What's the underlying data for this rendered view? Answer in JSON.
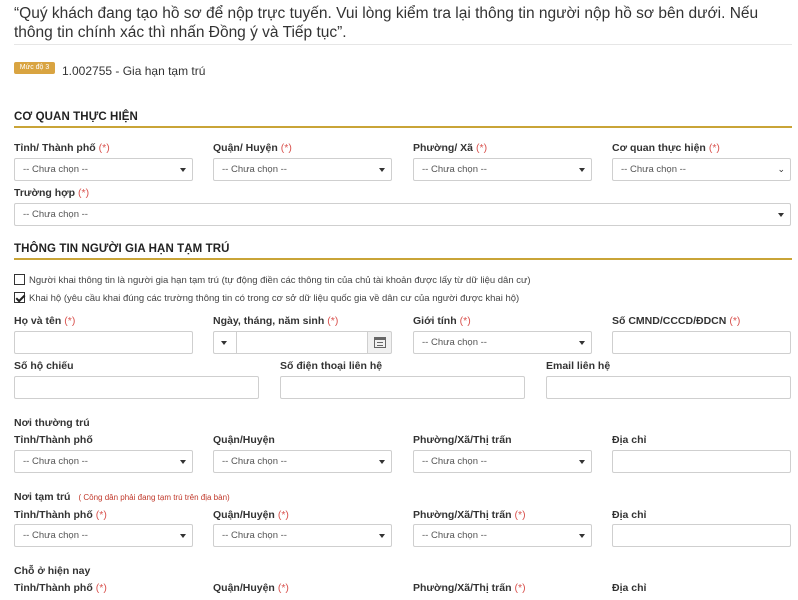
{
  "notice": "“Quý khách đang tạo hồ sơ để nộp trực tuyến. Vui lòng kiểm tra lại thông tin người nộp hồ sơ bên dưới. Nếu thông tin chính xác thì nhấn Đồng ý và Tiếp tục”.",
  "procedure": {
    "badge": "Mức độ 3",
    "code_name": "1.002755 - Gia hạn tạm trú"
  },
  "sections": {
    "agency": "CƠ QUAN THỰC HIỆN",
    "person": "THÔNG TIN NGƯỜI GIA HẠN TẠM TRÚ"
  },
  "required_mark": "(*)",
  "placeholder": "-- Chưa chọn --",
  "agency": {
    "province_label": "Tỉnh/ Thành phố",
    "district_label": "Quận/ Huyện",
    "ward_label": "Phường/ Xã",
    "office_label": "Cơ quan thực hiện",
    "case_label": "Trường hợp"
  },
  "checks": {
    "self": {
      "label": "Người khai thông tin là người gia hạn tạm trú (tự động điền các thông tin của chủ tài khoản được lấy từ dữ liệu dân cư)",
      "checked": false
    },
    "proxy": {
      "label": "Khai hộ (yêu cầu khai đúng các trường thông tin có trong cơ sở dữ liệu quốc gia về dân cư của người được khai hộ)",
      "checked": true
    }
  },
  "person": {
    "fullname_label": "Họ và tên",
    "dob_label": "Ngày, tháng, năm sinh",
    "gender_label": "Giới tính",
    "id_label": "Số CMND/CCCD/ĐDCN",
    "passport_label": "Số hộ chiếu",
    "phone_label": "Số điện thoại liên hệ",
    "email_label": "Email liên hệ"
  },
  "permanent": {
    "title": "Nơi thường trú",
    "province_label": "Tỉnh/Thành phố",
    "district_label": "Quận/Huyện",
    "ward_label": "Phường/Xã/Thị trấn",
    "address_label": "Địa chỉ"
  },
  "temporary": {
    "title": "Nơi tạm trú",
    "note": "( Công dân phải đang tạm trú trên địa bàn)",
    "province_label": "Tỉnh/Thành phố",
    "district_label": "Quận/Huyện",
    "ward_label": "Phường/Xã/Thị trấn",
    "address_label": "Địa chỉ"
  },
  "current": {
    "title": "Chỗ ở hiện nay",
    "province_label": "Tỉnh/Thành phố",
    "district_label": "Quận/Huyện",
    "ward_label": "Phường/Xã/Thị trấn",
    "address_label": "Địa chỉ"
  },
  "colors": {
    "accent": "#c9a437",
    "badge": "#d9a441",
    "required": "#d9534f"
  }
}
